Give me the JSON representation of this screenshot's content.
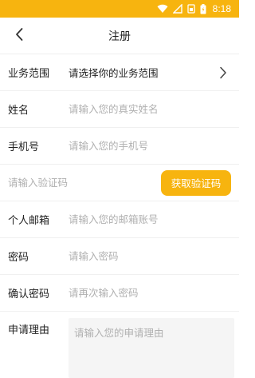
{
  "status_bar": {
    "time": "8:18",
    "icons": [
      "wifi-icon",
      "signal-icon",
      "sim-icon",
      "battery-icon"
    ],
    "background": "#f7b40f"
  },
  "nav": {
    "title": "注册",
    "back_icon": "chevron-left-icon"
  },
  "form": {
    "business": {
      "label": "业务范围",
      "value": "请选择你的业务范围",
      "chevron_icon": "chevron-right-icon"
    },
    "name": {
      "label": "姓名",
      "placeholder": "请输入您的真实姓名",
      "value": ""
    },
    "phone": {
      "label": "手机号",
      "placeholder": "请输入您的手机号",
      "value": ""
    },
    "code": {
      "placeholder": "请输入验证码",
      "value": "",
      "button_label": "获取验证码"
    },
    "email": {
      "label": "个人邮箱",
      "placeholder": "请输入您的邮箱账号",
      "value": ""
    },
    "password": {
      "label": "密码",
      "placeholder": "请输入密码",
      "value": ""
    },
    "confirm_password": {
      "label": "确认密码",
      "placeholder": "请再次输入密码",
      "value": ""
    },
    "reason": {
      "label": "申请理由",
      "placeholder": "请输入您的申请理由",
      "value": ""
    }
  },
  "colors": {
    "accent": "#f7b40f",
    "placeholder": "#b0b0b0",
    "text": "#222222"
  }
}
